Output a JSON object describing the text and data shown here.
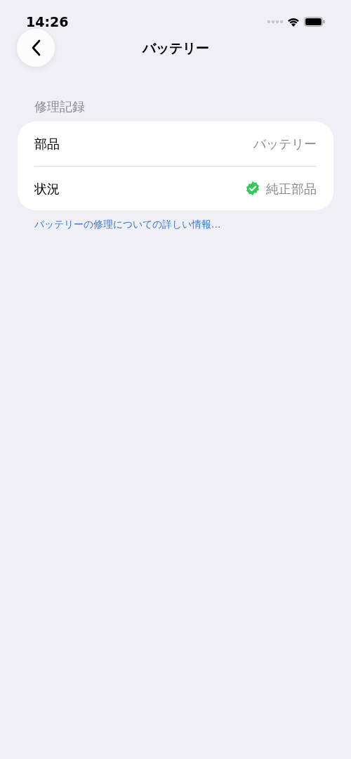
{
  "status_bar": {
    "time": "14:26"
  },
  "nav": {
    "title": "バッテリー"
  },
  "section": {
    "header": "修理記録",
    "rows": [
      {
        "label": "部品",
        "value": "バッテリー",
        "kind": "plain"
      },
      {
        "label": "状況",
        "value": "純正部品",
        "kind": "verified"
      }
    ],
    "footer_link": "バッテリーの修理についての詳しい情報..."
  }
}
